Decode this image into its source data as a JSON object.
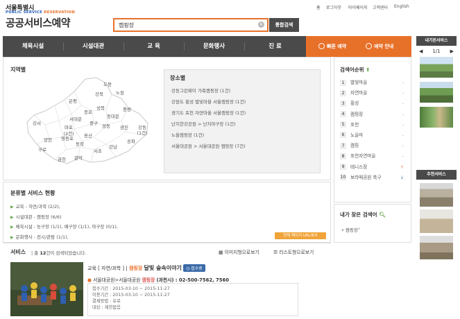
{
  "brand": {
    "city": "서울특별시",
    "sub_public": "PUBLIC SERVICE",
    "sub_reservation": "RESERVATION",
    "title": "공공서비스예약"
  },
  "util": [
    "홈",
    "로그아웃",
    "마이페이지",
    "고객센터",
    "English"
  ],
  "search": {
    "value": "캠핑장",
    "button": "통합검색"
  },
  "nav": {
    "items": [
      "체육시설",
      "시설대관",
      "교 육",
      "문화행사",
      "진 료"
    ],
    "quick": "빠른 예약",
    "guide": "예약 안내"
  },
  "region": {
    "title": "지역별",
    "districts": [
      "도봉",
      "강북",
      "노원",
      "은평",
      "성북",
      "중랑",
      "종로",
      "동대문",
      "서대문",
      "마포",
      "(2건)",
      "중구",
      "성동",
      "광진",
      "강동",
      "(1건)",
      "강서",
      "양천",
      "용산",
      "영등포",
      "구로",
      "동작",
      "송파",
      "금천",
      "관악",
      "서초",
      "강남"
    ]
  },
  "places": {
    "title": "장소별",
    "items": [
      "강동그린웨이 가족캠핑장 (1건)",
      "강원도 횡성 별빛마을 서울캠핑장 (1건)",
      "경기도 포천 자연마을 서울캠핑장 (1건)",
      "난지한강공원 > 난지야구장 (1건)",
      "노을캠핑장 (1건)",
      "서울대공원 > 서울대공원 캠핑장 (7건)"
    ]
  },
  "rank": {
    "title": "검색어순위",
    "items": [
      {
        "n": "1",
        "label": "별빛마을",
        "chg": "-"
      },
      {
        "n": "2",
        "label": "자연마을",
        "chg": "-"
      },
      {
        "n": "3",
        "label": "횡성",
        "chg": "-"
      },
      {
        "n": "4",
        "label": "캠핑장",
        "chg": "-"
      },
      {
        "n": "5",
        "label": "포천",
        "chg": "-"
      },
      {
        "n": "6",
        "label": "노을마",
        "chg": "-"
      },
      {
        "n": "7",
        "label": "캠핑",
        "chg": "-"
      },
      {
        "n": "8",
        "label": "포천자연마을",
        "chg": "-"
      },
      {
        "n": "9",
        "label": "테니스장",
        "chg": "↑"
      },
      {
        "n": "10",
        "label": "보라매공원 축구",
        "chg": "↓"
      }
    ]
  },
  "my_search": {
    "title": "내가 찾은 검색어",
    "items": [
      "캠핑장"
    ],
    "remove": "x"
  },
  "category": {
    "title": "분류별 서비스 현황",
    "items": [
      "교육 - 자연/과학 (2/2),",
      "시설대관 - 캠핑장 (6/6)",
      "체육시설 - 농구장 (1/1), 배구장 (1/1), 야구장 (0/1),",
      "문화행사 - 전시/관람 (1/1),"
    ],
    "url_badge": "현재 페이지 URL복사"
  },
  "services": {
    "title": "서비스",
    "total_prefix": "총",
    "total": "12",
    "total_suffix": "건이 검색되었습니다.",
    "view_image": "이미지형으로보기",
    "view_list": "리스트형으로보기"
  },
  "item": {
    "category": "교육 [ 자연/과학 ]",
    "sep": "|",
    "keyword": "캠핑장",
    "title": "달빛 숲속이야기",
    "status": "접수중",
    "location_prefix": "서울대공원>서울대공원",
    "location_kw": "캠핑장",
    "contact": "(과천시) : 02-500-7562, 7560",
    "details": [
      "접수기간 : 2015-03-10 ~ 2015-11-27",
      "이용기간 : 2015-03-10 ~ 2015-11-27",
      "결제방법 : 유료",
      "대상 : 제한없음"
    ]
  },
  "sidebar": {
    "recent_title": "내가본서비스",
    "pager": "1/1",
    "recommend_title": "추천서비스"
  }
}
